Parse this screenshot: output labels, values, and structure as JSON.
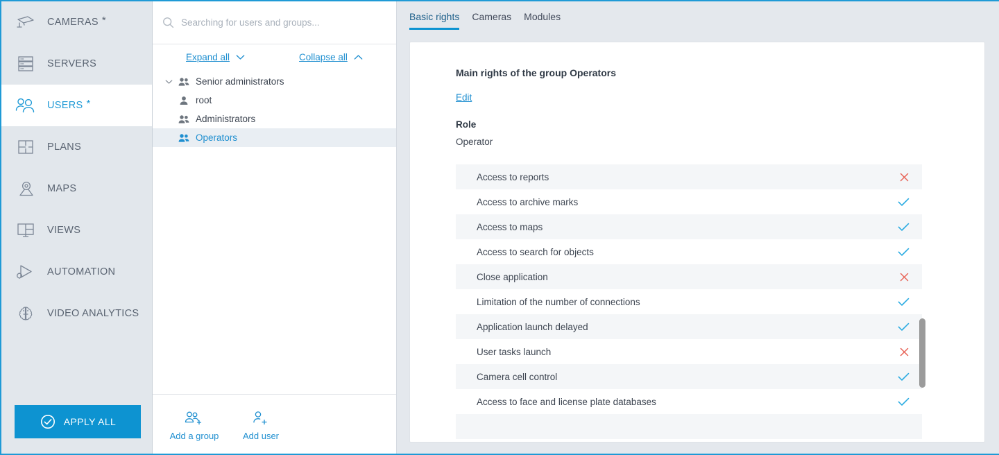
{
  "theme": {
    "accent": "#0d93d1",
    "link": "#1f8fd0",
    "text": "#3c4450",
    "sidebar_bg": "#e2e7ec",
    "panel_bg": "#e4e8ed",
    "allow_color": "#29abe2",
    "deny_color": "#e8665a",
    "stripe_bg": "#f4f6f8"
  },
  "sidebar": {
    "items": [
      {
        "label": "CAMERAS",
        "icon": "camera-icon",
        "star": "*",
        "active": false
      },
      {
        "label": "SERVERS",
        "icon": "servers-icon",
        "star": "",
        "active": false
      },
      {
        "label": "USERS",
        "icon": "users-icon",
        "star": "*",
        "active": true
      },
      {
        "label": "PLANS",
        "icon": "plans-icon",
        "star": "",
        "active": false
      },
      {
        "label": "MAPS",
        "icon": "map-pin-icon",
        "star": "",
        "active": false
      },
      {
        "label": "VIEWS",
        "icon": "views-icon",
        "star": "",
        "active": false
      },
      {
        "label": "AUTOMATION",
        "icon": "automation-icon",
        "star": "",
        "active": false
      },
      {
        "label": "VIDEO ANALYTICS",
        "icon": "brain-icon",
        "star": "",
        "active": false
      }
    ],
    "apply_all_label": "APPLY ALL",
    "apply_all_icon": "check-circle-icon"
  },
  "tree_panel": {
    "search": {
      "icon": "search-icon",
      "placeholder": "Searching for users and groups...",
      "value": ""
    },
    "expand_all_label": "Expand all",
    "expand_all_icon": "chevron-down-icon",
    "collapse_all_label": "Collapse all",
    "collapse_all_icon": "chevron-up-icon",
    "nodes": [
      {
        "label": "Senior administrators",
        "icon": "group-icon",
        "level": 0,
        "expanded": true,
        "twisty": "chevron-down-icon",
        "selected": false
      },
      {
        "label": "root",
        "icon": "user-icon",
        "level": 1,
        "expanded": false,
        "twisty": "",
        "selected": false
      },
      {
        "label": "Administrators",
        "icon": "group-icon",
        "level": 0,
        "expanded": false,
        "twisty": "",
        "selected": false
      },
      {
        "label": "Operators",
        "icon": "group-icon",
        "level": 0,
        "expanded": false,
        "twisty": "",
        "selected": true
      }
    ],
    "footer": [
      {
        "label": "Add a group",
        "icon": "add-group-icon"
      },
      {
        "label": "Add user",
        "icon": "add-user-icon"
      }
    ]
  },
  "content": {
    "tabs": [
      {
        "label": "Basic rights",
        "active": true
      },
      {
        "label": "Cameras",
        "active": false
      },
      {
        "label": "Modules",
        "active": false
      }
    ],
    "title": "Main rights of the group Operators",
    "edit_label": "Edit",
    "role_heading": "Role",
    "role_value": "Operator",
    "rights": [
      {
        "label": "Access to reports",
        "allowed": false
      },
      {
        "label": "Access to archive marks",
        "allowed": true
      },
      {
        "label": "Access to maps",
        "allowed": true
      },
      {
        "label": "Access to search for objects",
        "allowed": true
      },
      {
        "label": "Close application",
        "allowed": false
      },
      {
        "label": "Limitation of the number of connections",
        "allowed": true
      },
      {
        "label": "Application launch delayed",
        "allowed": true
      },
      {
        "label": "User tasks launch",
        "allowed": false
      },
      {
        "label": "Camera cell control",
        "allowed": true
      },
      {
        "label": "Access to face and license plate databases",
        "allowed": true
      },
      {
        "label": "",
        "allowed": null
      }
    ],
    "scrollbar": {
      "name": "rights-scrollbar"
    }
  }
}
